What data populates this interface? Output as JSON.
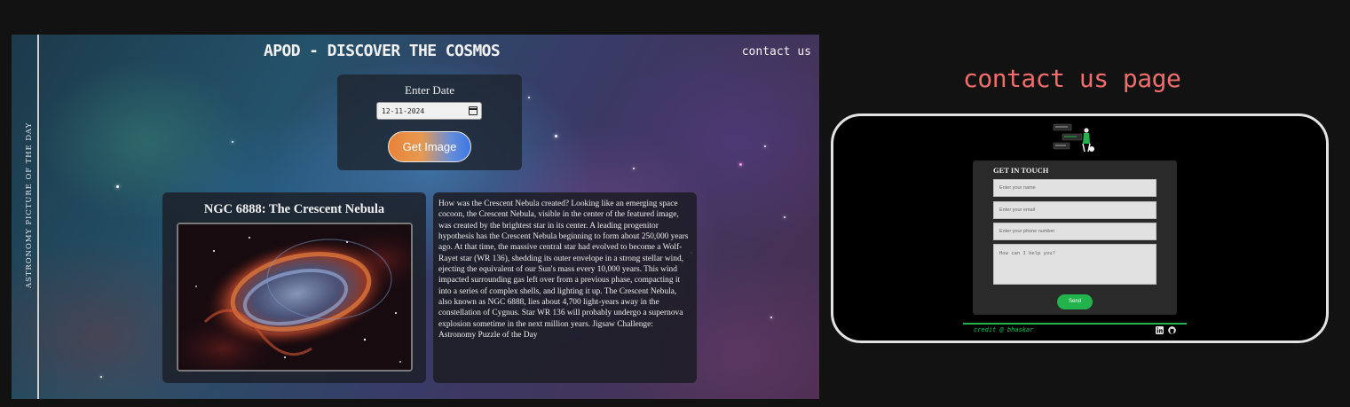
{
  "apod": {
    "vertical_title": "ASTRONOMY PICTURE OF THE DAY",
    "header_title": "APOD - DISCOVER THE COSMOS",
    "contact_link": "contact us",
    "date_label": "Enter Date",
    "date_value": "12-11-2024",
    "get_image_button": "Get Image",
    "image_title": "NGC 6888: The Crescent Nebula",
    "description": "How was the Crescent Nebula created? Looking like an emerging space cocoon, the Crescent Nebula, visible in the center of the featured image, was created by the brightest star in its center. A leading progenitor hypothesis has the Crescent Nebula beginning to form about 250,000 years ago. At that time, the massive central star had evolved to become a Wolf-Rayet star (WR 136), shedding its outer envelope in a strong stellar wind, ejecting the equivalent of our Sun's mass every 10,000 years. This wind impacted surrounding gas left over from a previous phase, compacting it into a series of complex shells, and lighting it up. The Crescent Nebula, also known as NGC 6888, lies about 4,700 light-years away in the constellation of Cygnus. Star WR 136 will probably undergo a supernova explosion sometime in the next million years. Jigsaw Challenge: Astronomy Puzzle of the Day"
  },
  "contact_page": {
    "heading": "contact us page",
    "form_title": "GET IN TOUCH",
    "name_placeholder": "Enter your name",
    "email_placeholder": "Enter your email",
    "phone_placeholder": "Enter your phone number",
    "message_placeholder": "How can I help you?",
    "send_button": "Send",
    "credit": "credit @ bhaskar",
    "social_icons": [
      "linkedin-icon",
      "github-icon"
    ]
  },
  "colors": {
    "background": "#121212",
    "heading_accent": "#f26c6c",
    "send_green": "#22b34c",
    "button_gradient_start": "#e9823a",
    "button_gradient_end": "#3a78e6"
  }
}
